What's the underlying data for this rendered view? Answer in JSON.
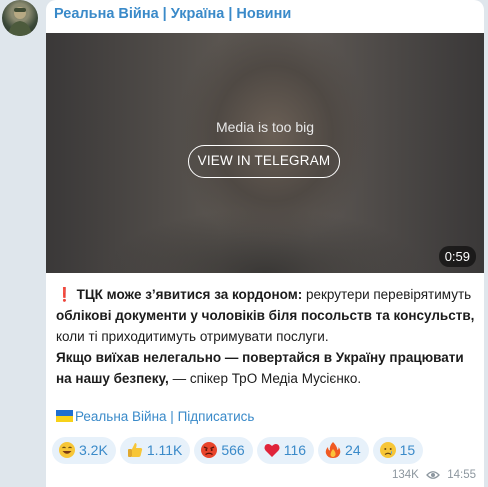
{
  "channel": {
    "name": "Реальна Війна | Україна | Новини"
  },
  "media": {
    "notice": "Media is too big",
    "button_label": "VIEW IN TELEGRAM",
    "duration": "0:59"
  },
  "message": {
    "excl_icon": "❗",
    "part1_bold": "ТЦК може з’явитися за кордоном:",
    "part2": " рекрутери перевірятимуть ",
    "part3_bold": "облікові документи у чоловіків біля посольств та консульств,",
    "part4": " коли ті приходитимуть отримувати послуги.",
    "part5_bold": "Якщо виїхав нелегально — повертайся в Україну працювати на нашу безпеку,",
    "part6": " — спікер ТрО Медіа Мусієнко."
  },
  "subscribe": {
    "text": "Реальна Війна | Підписатись"
  },
  "reactions": [
    {
      "emoji": "laugh-emoji",
      "count": "3.2K"
    },
    {
      "emoji": "thumbs-up-emoji",
      "count": "1.11K"
    },
    {
      "emoji": "angry-emoji",
      "count": "566"
    },
    {
      "emoji": "heart-emoji",
      "count": "116"
    },
    {
      "emoji": "fire-emoji",
      "count": "24"
    },
    {
      "emoji": "crying-emoji",
      "count": "15"
    }
  ],
  "meta": {
    "views": "134K",
    "time": "14:55"
  },
  "colors": {
    "accent": "#3a8ac9",
    "background": "#dfe6ec",
    "reaction_bg": "#e7f1fa"
  }
}
